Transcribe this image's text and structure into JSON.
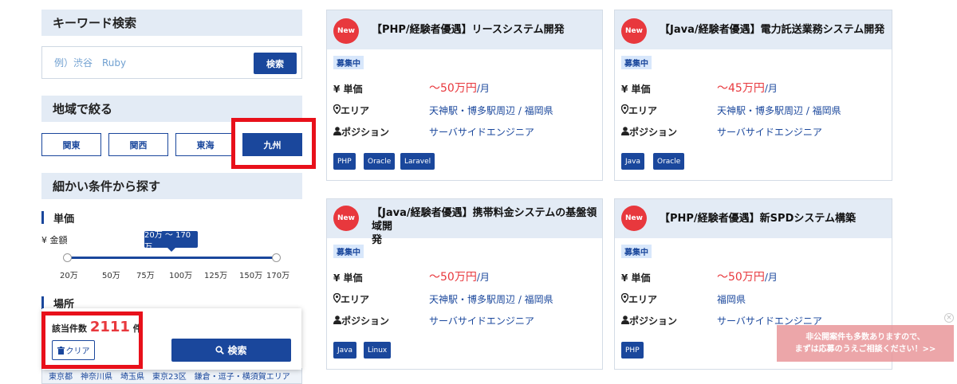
{
  "sidebar": {
    "keyword": {
      "title": "キーワード検索",
      "placeholder": "例）渋谷　Ruby",
      "search_label": "検索"
    },
    "region": {
      "title": "地域で絞る",
      "buttons": [
        "関東",
        "関西",
        "東海",
        "九州"
      ],
      "active": "九州"
    },
    "detail": {
      "title": "細かい条件から探す"
    },
    "price": {
      "title": "単価",
      "amount_label": "¥ 金額",
      "range_label": "20万 〜 170万",
      "ticks": [
        "20万",
        "50万",
        "75万",
        "100万",
        "125万",
        "150万",
        "170万"
      ],
      "min": 20,
      "max": 170,
      "selected": [
        20,
        170
      ]
    },
    "place": {
      "title": "場所"
    },
    "result": {
      "count_prefix": "該当件数",
      "count": "2111",
      "count_suffix": "件",
      "clear_label": "クリア",
      "search_label": "検索"
    },
    "pref_strip": "東京都　神奈川県　埼玉県　東京23区　鎌倉・逗子・横須賀エリア"
  },
  "labels": {
    "new": "New",
    "open": "募集中",
    "price": "¥ 単価",
    "area": "エリア",
    "position": "ポジション"
  },
  "jobs": [
    {
      "title": "【PHP/経験者優遇】リースシステム開発",
      "price": "〜50万円",
      "unit": "/月",
      "area": "天神駅・博多駅周辺 / 福岡県",
      "position": "サーバサイドエンジニア",
      "skills": [
        "PHP",
        "Oracle",
        "Laravel"
      ]
    },
    {
      "title": "【Java/経験者優遇】電力託送業務システム開発",
      "price": "〜45万円",
      "unit": "/月",
      "area": "天神駅・博多駅周辺 / 福岡県",
      "position": "サーバサイドエンジニア",
      "skills": [
        "Java",
        "Oracle"
      ]
    },
    {
      "title_line1": "【Java/経験者優遇】携帯料金システムの基盤領域開",
      "title_line2": "発",
      "price": "〜50万円",
      "unit": "/月",
      "area": "天神駅・博多駅周辺 / 福岡県",
      "position": "サーバサイドエンジニア",
      "skills": [
        "Java",
        "Linux"
      ]
    },
    {
      "title": "【PHP/経験者優遇】新SPDシステム構築",
      "price": "〜50万円",
      "unit": "/月",
      "area": "福岡県",
      "position": "サーバサイドエンジニア",
      "skills": [
        "PHP"
      ]
    }
  ],
  "banner": {
    "line1": "非公開案件も多数ありますので、",
    "line2": "まずは応募のうえご相談ください！>>"
  },
  "colors": {
    "primary": "#1a479c",
    "accent_red": "#e8383d",
    "highlight_frame": "#e8101a",
    "header_bg": "#e3ebf5"
  }
}
